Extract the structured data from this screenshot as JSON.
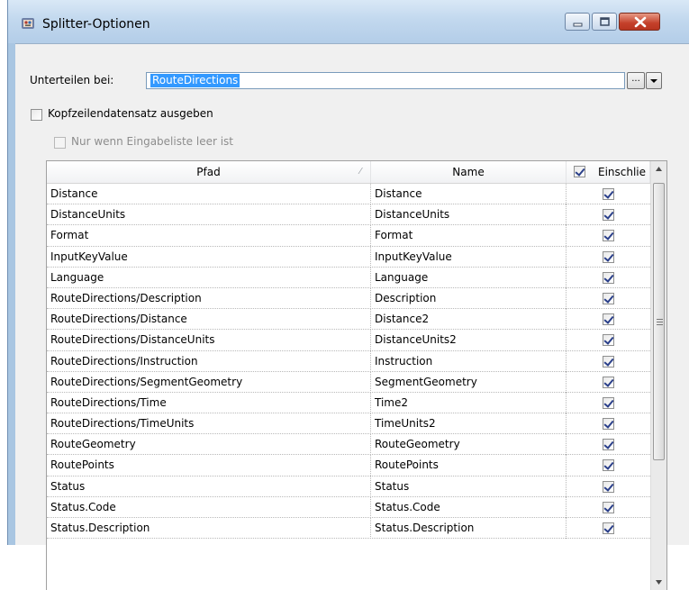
{
  "window": {
    "title": "Splitter-Optionen",
    "buttons": [
      "minimize",
      "maximize",
      "close"
    ]
  },
  "split": {
    "label": "Unterteilen bei:",
    "value": "RouteDirections",
    "ellipsis_label": "...",
    "dropdown": "chevron-down-icon"
  },
  "options": {
    "header_record_label": "Kopfzeilendatensatz ausgeben",
    "header_record_checked": false,
    "only_empty_label": "Nur wenn Eingabeliste leer ist",
    "only_empty_checked": false,
    "only_empty_enabled": false
  },
  "grid": {
    "columns": [
      "Pfad",
      "Name",
      "Einschlie"
    ],
    "include_all_checked": true,
    "rows": [
      {
        "pfad": "Distance",
        "name": "Distance",
        "include": true
      },
      {
        "pfad": "DistanceUnits",
        "name": "DistanceUnits",
        "include": true
      },
      {
        "pfad": "Format",
        "name": "Format",
        "include": true
      },
      {
        "pfad": "InputKeyValue",
        "name": "InputKeyValue",
        "include": true
      },
      {
        "pfad": "Language",
        "name": "Language",
        "include": true
      },
      {
        "pfad": "RouteDirections/Description",
        "name": "Description",
        "include": true
      },
      {
        "pfad": "RouteDirections/Distance",
        "name": "Distance2",
        "include": true
      },
      {
        "pfad": "RouteDirections/DistanceUnits",
        "name": "DistanceUnits2",
        "include": true
      },
      {
        "pfad": "RouteDirections/Instruction",
        "name": "Instruction",
        "include": true
      },
      {
        "pfad": "RouteDirections/SegmentGeometry",
        "name": "SegmentGeometry",
        "include": true
      },
      {
        "pfad": "RouteDirections/Time",
        "name": "Time2",
        "include": true
      },
      {
        "pfad": "RouteDirections/TimeUnits",
        "name": "TimeUnits2",
        "include": true
      },
      {
        "pfad": "RouteGeometry",
        "name": "RouteGeometry",
        "include": true
      },
      {
        "pfad": "RoutePoints",
        "name": "RoutePoints",
        "include": true
      },
      {
        "pfad": "Status",
        "name": "Status",
        "include": true
      },
      {
        "pfad": "Status.Code",
        "name": "Status.Code",
        "include": true
      },
      {
        "pfad": "Status.Description",
        "name": "Status.Description",
        "include": true
      }
    ]
  }
}
